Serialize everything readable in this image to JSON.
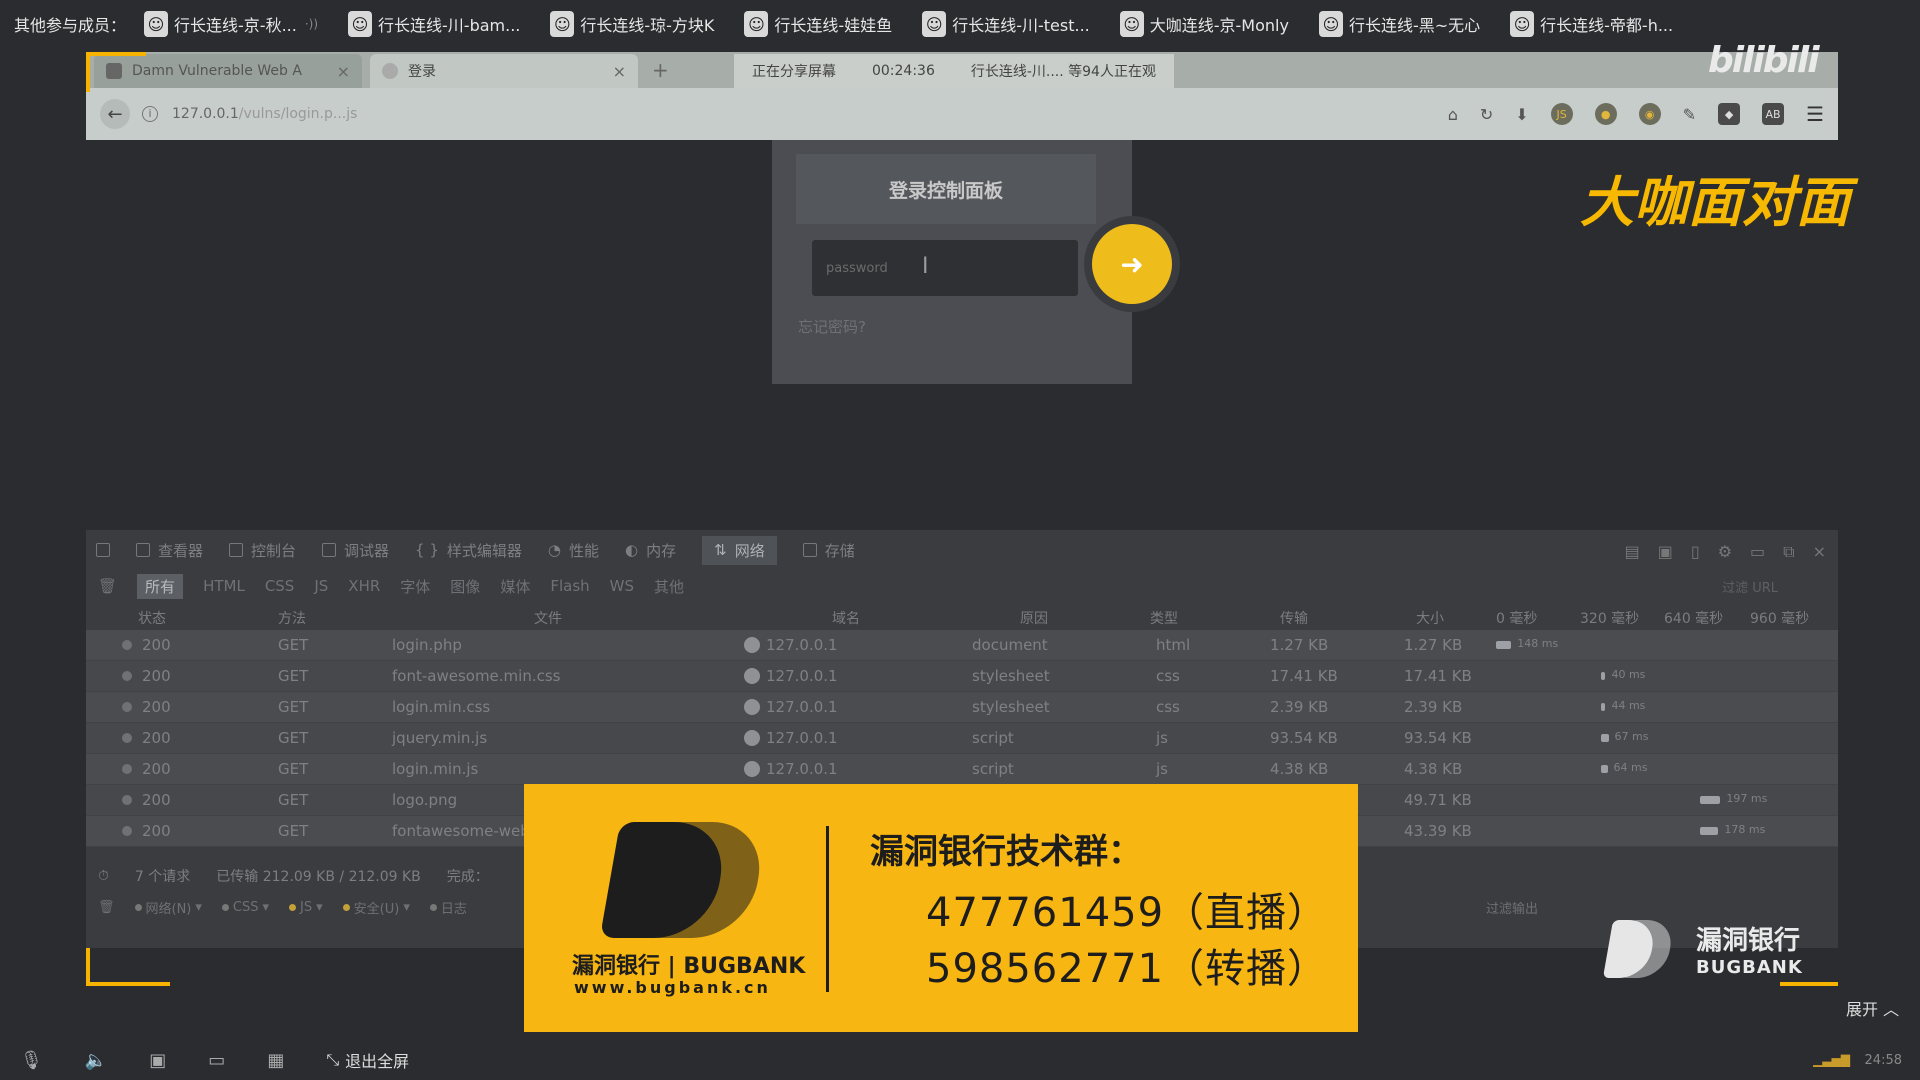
{
  "participants": {
    "label": "其他参与成员：",
    "items": [
      {
        "name": "行长连线-京-秋..."
      },
      {
        "name": "行长连线-川-bam..."
      },
      {
        "name": "行长连线-琼-方块K"
      },
      {
        "name": "行长连线-娃娃鱼"
      },
      {
        "name": "行长连线-川-test..."
      },
      {
        "name": "大咖连线-京-Monly"
      },
      {
        "name": "行长连线-黑~无心"
      },
      {
        "name": "行长连线-帝都-h..."
      }
    ]
  },
  "browser": {
    "tabs": [
      {
        "label": "Damn Vulnerable Web A"
      },
      {
        "label": "登录"
      }
    ],
    "share": {
      "status": "正在分享屏幕",
      "time": "00:24:36",
      "viewers": "行长连线-川.... 等94人正在观"
    },
    "url": {
      "host": "127.0.0.1",
      "path": "/vulns/login.p...js"
    }
  },
  "overlay": {
    "daka": "大咖面对面",
    "bili": "bilibili"
  },
  "login": {
    "title": "登录控制面板",
    "password_placeholder": "password",
    "forgot": "忘记密码?"
  },
  "devtools": {
    "tabs": [
      "查看器",
      "控制台",
      "调试器",
      "样式编辑器",
      "性能",
      "内存",
      "网络",
      "存储"
    ],
    "active_tab": "网络",
    "filters": [
      "所有",
      "HTML",
      "CSS",
      "JS",
      "XHR",
      "字体",
      "图像",
      "媒体",
      "Flash",
      "WS",
      "其他"
    ],
    "url_filter_placeholder": "过滤 URL",
    "columns": {
      "status": "状态",
      "method": "方法",
      "file": "文件",
      "domain": "域名",
      "cause": "原因",
      "type": "类型",
      "transferred": "传输",
      "size": "大小",
      "t0": "0 毫秒",
      "t320": "320 毫秒",
      "t640": "640 毫秒",
      "t960": "960 毫秒"
    },
    "requests": [
      {
        "status": "200",
        "method": "GET",
        "file": "login.php",
        "domain": "127.0.0.1",
        "cause": "document",
        "type": "html",
        "transferred": "1.27 KB",
        "size": "1.27 KB",
        "time": "148 ms",
        "bar_start": 0,
        "bar_len": 0.15
      },
      {
        "status": "200",
        "method": "GET",
        "file": "font-awesome.min.css",
        "domain": "127.0.0.1",
        "cause": "stylesheet",
        "type": "css",
        "transferred": "17.41 KB",
        "size": "17.41 KB",
        "time": "40 ms",
        "bar_start": 0.31,
        "bar_len": 0.04
      },
      {
        "status": "200",
        "method": "GET",
        "file": "login.min.css",
        "domain": "127.0.0.1",
        "cause": "stylesheet",
        "type": "css",
        "transferred": "2.39 KB",
        "size": "2.39 KB",
        "time": "44 ms",
        "bar_start": 0.31,
        "bar_len": 0.04
      },
      {
        "status": "200",
        "method": "GET",
        "file": "jquery.min.js",
        "domain": "127.0.0.1",
        "cause": "script",
        "type": "js",
        "transferred": "93.54 KB",
        "size": "93.54 KB",
        "time": "67 ms",
        "bar_start": 0.31,
        "bar_len": 0.07
      },
      {
        "status": "200",
        "method": "GET",
        "file": "login.min.js",
        "domain": "127.0.0.1",
        "cause": "script",
        "type": "js",
        "transferred": "4.38 KB",
        "size": "4.38 KB",
        "time": "64 ms",
        "bar_start": 0.31,
        "bar_len": 0.06
      },
      {
        "status": "200",
        "method": "GET",
        "file": "logo.png",
        "domain": "",
        "cause": "",
        "type": "",
        "transferred": "",
        "size": "49.71 KB",
        "time": "197 ms",
        "bar_start": 0.6,
        "bar_len": 0.2
      },
      {
        "status": "200",
        "method": "GET",
        "file": "fontawesome-web...",
        "domain": "",
        "cause": "",
        "type": "",
        "transferred": "",
        "size": "43.39 KB",
        "time": "178 ms",
        "bar_start": 0.6,
        "bar_len": 0.18
      }
    ],
    "summary": {
      "count": "7 个请求",
      "transferred": "已传输 212.09 KB / 212.09 KB",
      "finished": "完成："
    },
    "console_filters": [
      "网络(N)",
      "CSS",
      "JS",
      "安全(U)",
      "日志"
    ],
    "console_filter_placeholder": "过滤输出"
  },
  "ad": {
    "brand": "漏洞银行 | BUGBANK",
    "site": "www.bugbank.cn",
    "heading": "漏洞银行技术群：",
    "line1": "477761459（直播）",
    "line2": "598562771（转播）"
  },
  "bugbank_logo": {
    "cn": "漏洞银行",
    "en": "BUGBANK"
  },
  "expand_label": "展开",
  "player": {
    "exit_fullscreen": "退出全屏",
    "clock": "24:58"
  }
}
